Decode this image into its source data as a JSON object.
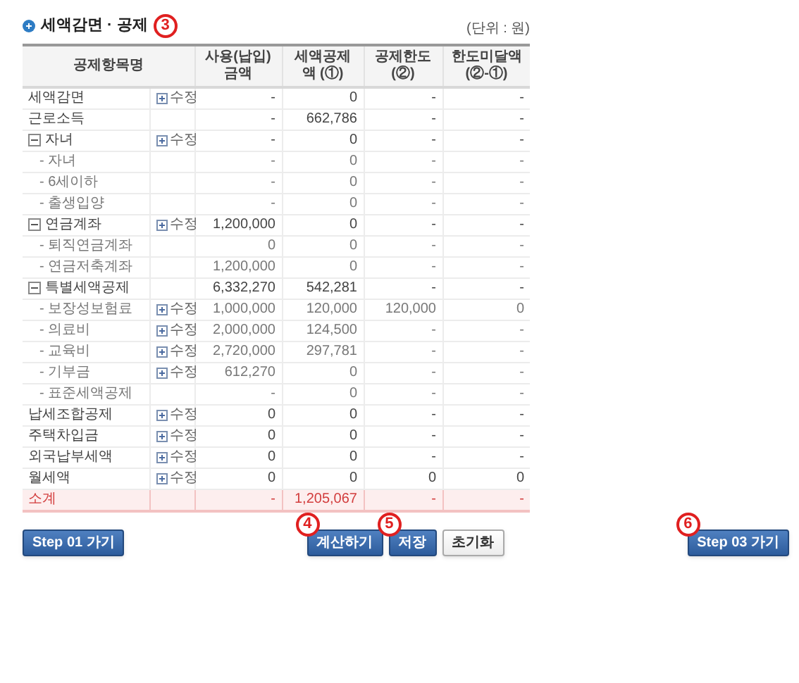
{
  "title": "세액감면 · 공제",
  "title_marker": "3",
  "unit": "(단위 : 원)",
  "columns": [
    "공제항목명",
    "사용(납입)금액",
    "세액공제액 (①)",
    "공제한도 (②)",
    "한도미달액 (②-①)"
  ],
  "rows": [
    {
      "kind": "item",
      "name": "세액감면",
      "edit": "수정",
      "cells": [
        "-",
        "0",
        "-",
        "-"
      ]
    },
    {
      "kind": "item",
      "name": "근로소득",
      "cells": [
        "-",
        "662,786",
        "-",
        "-"
      ]
    },
    {
      "kind": "item",
      "name": "자녀",
      "expanded": true,
      "edit": "수정",
      "cells": [
        "-",
        "0",
        "-",
        "-"
      ],
      "children": [
        {
          "kind": "item",
          "name": "- 자녀",
          "cells": [
            "-",
            "0",
            "-",
            "-"
          ]
        },
        {
          "kind": "item",
          "name": "- 6세이하",
          "cells": [
            "-",
            "0",
            "-",
            "-"
          ]
        },
        {
          "kind": "item",
          "name": "- 출생입양",
          "cells": [
            "-",
            "0",
            "-",
            "-"
          ]
        }
      ]
    },
    {
      "kind": "item",
      "name": "연금계좌",
      "expanded": true,
      "edit": "수정",
      "cells": [
        "1,200,000",
        "0",
        "-",
        "-"
      ],
      "children": [
        {
          "kind": "item",
          "name": "- 퇴직연금계좌",
          "cells": [
            "0",
            "0",
            "-",
            "-"
          ]
        },
        {
          "kind": "item",
          "name": "- 연금저축계좌",
          "cells": [
            "1,200,000",
            "0",
            "-",
            "-"
          ]
        }
      ]
    },
    {
      "kind": "item",
      "name": "특별세액공제",
      "expanded": true,
      "cells": [
        "6,332,270",
        "542,281",
        "-",
        "-"
      ],
      "children": [
        {
          "kind": "item",
          "name": "- 보장성보험료",
          "edit": "수정",
          "cells": [
            "1,000,000",
            "120,000",
            "120,000",
            "0"
          ]
        },
        {
          "kind": "item",
          "name": "- 의료비",
          "edit": "수정",
          "cells": [
            "2,000,000",
            "124,500",
            "-",
            "-"
          ]
        },
        {
          "kind": "item",
          "name": "- 교육비",
          "edit": "수정",
          "cells": [
            "2,720,000",
            "297,781",
            "-",
            "-"
          ]
        },
        {
          "kind": "item",
          "name": "- 기부금",
          "edit": "수정",
          "cells": [
            "612,270",
            "0",
            "-",
            "-"
          ]
        },
        {
          "kind": "item",
          "name": "- 표준세액공제",
          "cells": [
            "-",
            "0",
            "-",
            "-"
          ]
        }
      ]
    },
    {
      "kind": "item",
      "name": "납세조합공제",
      "edit": "수정",
      "cells": [
        "0",
        "0",
        "-",
        "-"
      ]
    },
    {
      "kind": "item",
      "name": "주택차입금",
      "edit": "수정",
      "cells": [
        "0",
        "0",
        "-",
        "-"
      ]
    },
    {
      "kind": "item",
      "name": "외국납부세액",
      "edit": "수정",
      "cells": [
        "0",
        "0",
        "-",
        "-"
      ]
    },
    {
      "kind": "item",
      "name": "월세액",
      "edit": "수정",
      "cells": [
        "0",
        "0",
        "0",
        "0"
      ]
    },
    {
      "kind": "total",
      "name": "소계",
      "cells": [
        "-",
        "1,205,067",
        "-",
        "-"
      ]
    }
  ],
  "prev_button": {
    "label": "Step 01 가기",
    "kind": "primary"
  },
  "action_buttons": [
    {
      "label": "계산하기",
      "kind": "primary",
      "marker": "4"
    },
    {
      "label": "저장",
      "kind": "primary",
      "marker": "5"
    },
    {
      "label": "초기화",
      "kind": "secondary"
    }
  ],
  "next_button": {
    "label": "Step 03 가기",
    "kind": "primary",
    "marker": "6"
  }
}
